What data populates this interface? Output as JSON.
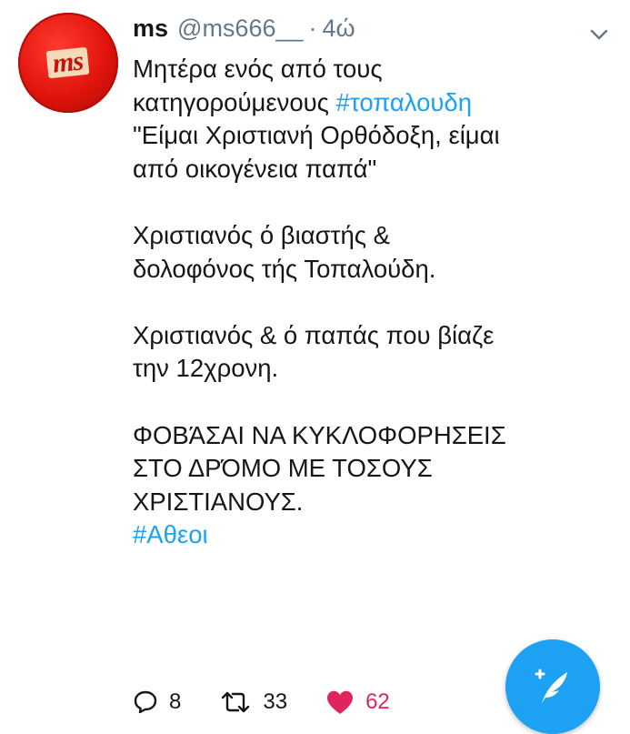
{
  "tweet": {
    "display_name": "ms",
    "handle": "@ms666__",
    "separator": "·",
    "time": "4ώ",
    "avatar_text": "ms",
    "lines": [
      {
        "text": "Μητέρα ενός από τους",
        "hashtag": false
      },
      {
        "text": "κατηγορούμενους ",
        "tag": "#τοπαλουδη"
      },
      {
        "text": "\"Είμαι Χριστιανή Ορθόδοξη, είμαι",
        "hashtag": false
      },
      {
        "text": "από οικογένεια παπά\"",
        "hashtag": false
      },
      {
        "text": "Χριστιανός ό βιαστής &",
        "hashtag": false
      },
      {
        "text": "δολοφόνος τής Τοπαλούδη.",
        "hashtag": false
      },
      {
        "text": "Χριστιανός & ό παπάς που βίαζε",
        "hashtag": false
      },
      {
        "text": "την 12χρονη.",
        "hashtag": false
      },
      {
        "text": "ΦΟΒΆΣΑΙ ΝΑ ΚΥΚΛΟΦΟΡΗΣΕΙΣ",
        "hashtag": false
      },
      {
        "text": "ΣΤΟ ΔΡΌΜΟ ΜΕ ΤΟΣΟΥΣ",
        "hashtag": false
      },
      {
        "text": "ΧΡΙΣΤΙΑΝΟΥΣ.",
        "hashtag": false
      },
      {
        "tag": "#Αθεοι"
      }
    ]
  },
  "actions": {
    "replies": "8",
    "retweets": "33",
    "likes": "62"
  },
  "colors": {
    "link": "#1da1f2",
    "like": "#e0245e",
    "muted": "#657786"
  },
  "icons": [
    "chevron-down-icon",
    "reply-icon",
    "retweet-icon",
    "heart-icon",
    "compose-tweet-icon"
  ]
}
